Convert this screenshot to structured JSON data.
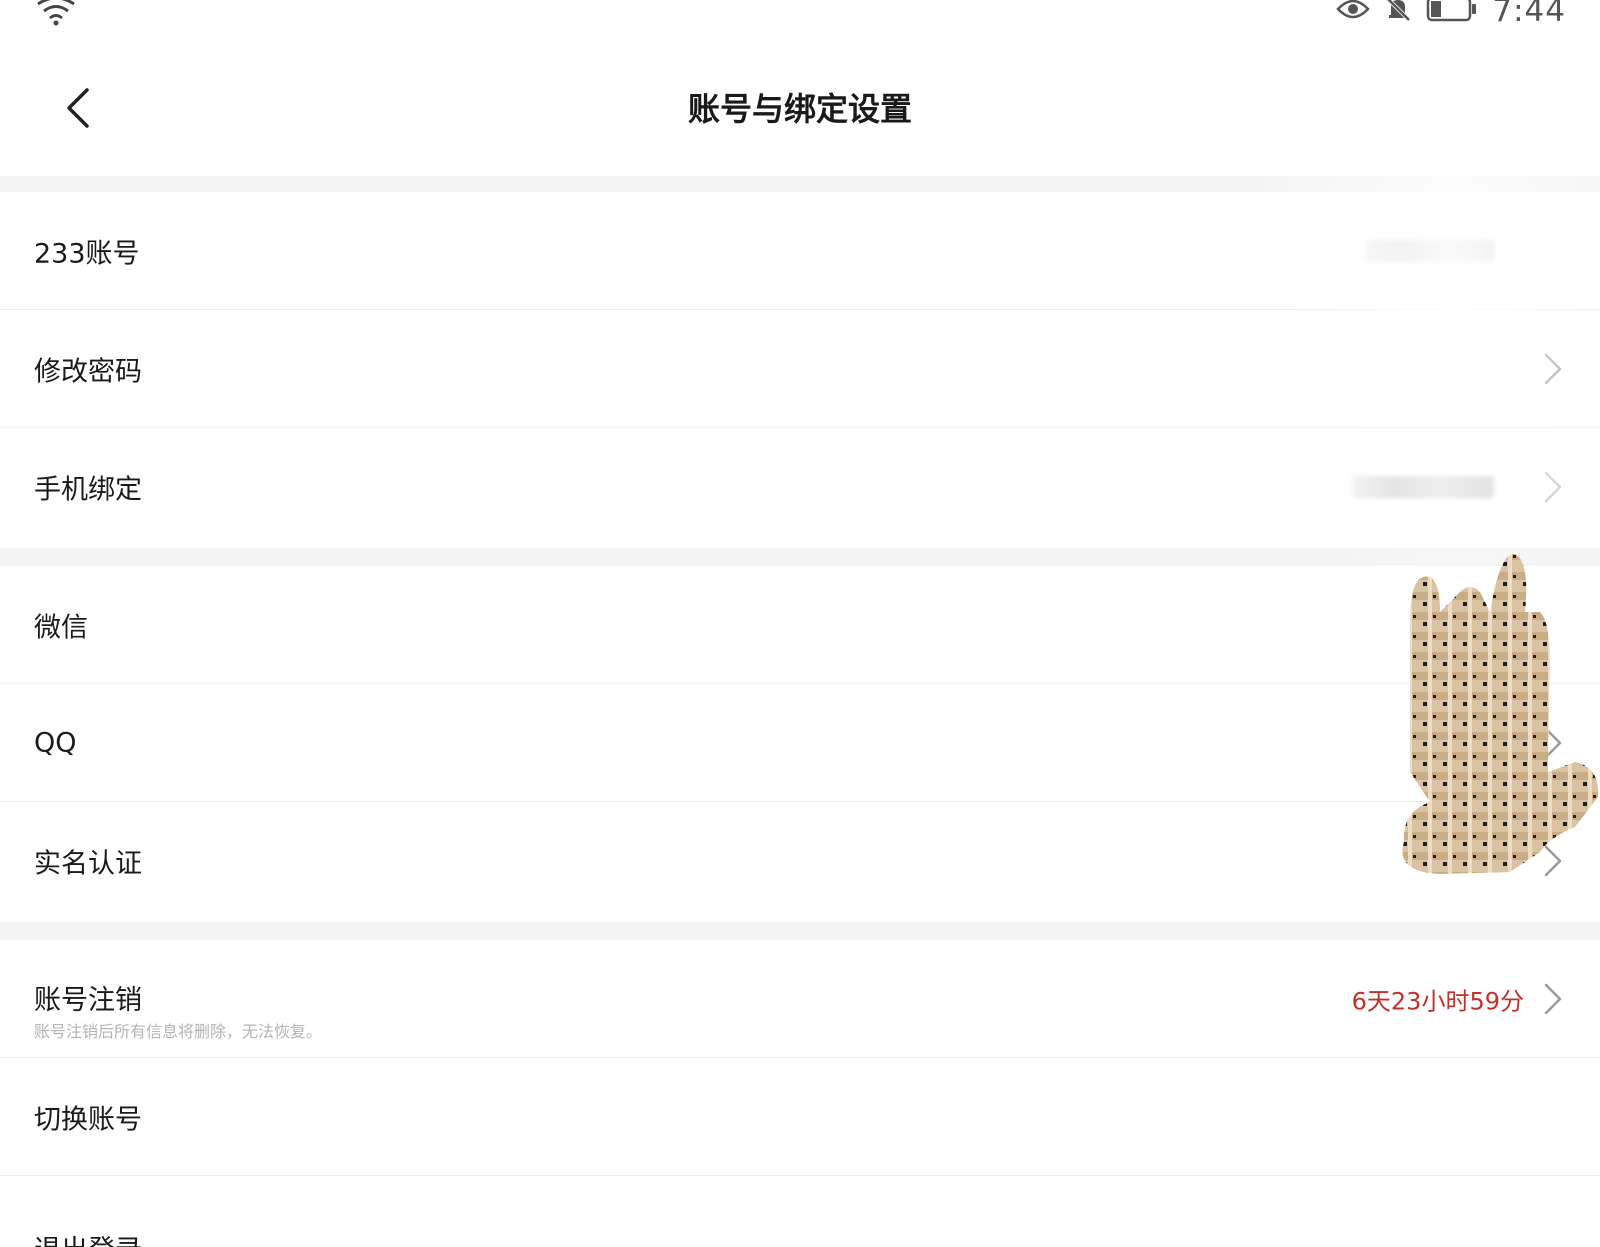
{
  "status_bar": {
    "time": "7:44",
    "icons": [
      "wifi-icon",
      "eye-icon",
      "bell-off-icon",
      "battery-icon"
    ]
  },
  "header": {
    "title": "账号与绑定设置",
    "back_icon": "chevron-left-icon"
  },
  "groups": [
    {
      "rows": [
        {
          "label": "233账号",
          "value_redacted": true,
          "chevron": false
        },
        {
          "label": "修改密码",
          "chevron": true
        },
        {
          "label": "手机绑定",
          "value_redacted": true,
          "chevron": true
        }
      ]
    },
    {
      "rows": [
        {
          "label": "微信",
          "chevron": false
        },
        {
          "label": "QQ",
          "chevron": true
        },
        {
          "label": "实名认证",
          "chevron": true
        }
      ]
    },
    {
      "rows": [
        {
          "label": "账号注销",
          "sublabel": "账号注销后所有信息将删除，无法恢复。",
          "value": "6天23小时59分",
          "chevron": true
        },
        {
          "label": "切换账号",
          "chevron": false
        },
        {
          "label": "退出登录",
          "chevron": false
        }
      ]
    }
  ],
  "colors": {
    "background": "#f4f4f4",
    "surface": "#ffffff",
    "text_primary": "#1a1a1a",
    "text_secondary": "#b4b4b4",
    "countdown": "#c0322d",
    "divider": "#ececec"
  }
}
